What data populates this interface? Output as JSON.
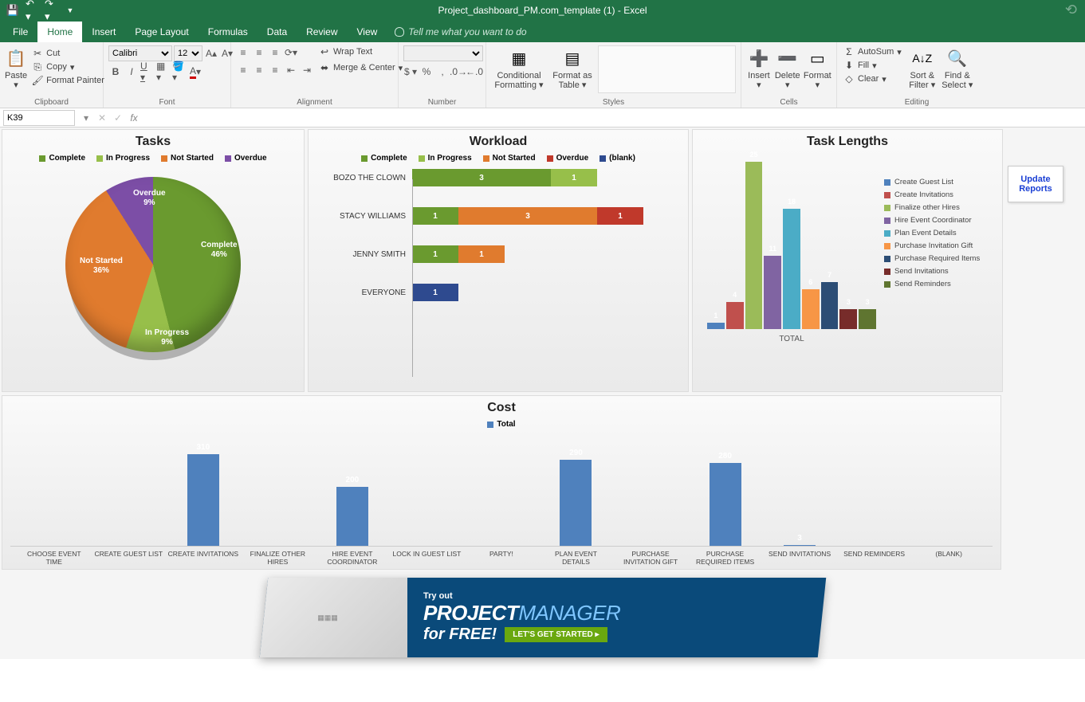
{
  "app": {
    "title": "Project_dashboard_PM.com_template (1) - Excel"
  },
  "qat": {
    "save": "💾",
    "undo": "↶",
    "redo": "↷"
  },
  "tabs": [
    "File",
    "Home",
    "Insert",
    "Page Layout",
    "Formulas",
    "Data",
    "Review",
    "View"
  ],
  "tell_me": "Tell me what you want to do",
  "ribbon": {
    "clipboard": {
      "label": "Clipboard",
      "paste": "Paste",
      "cut": "Cut",
      "copy": "Copy",
      "fmt": "Format Painter"
    },
    "font": {
      "label": "Font",
      "name": "Calibri",
      "size": "12"
    },
    "alignment": {
      "label": "Alignment",
      "wrap": "Wrap Text",
      "merge": "Merge & Center"
    },
    "number": {
      "label": "Number"
    },
    "styles": {
      "label": "Styles",
      "cf": "Conditional Formatting",
      "ft": "Format as Table"
    },
    "cells": {
      "label": "Cells",
      "insert": "Insert",
      "delete": "Delete",
      "format": "Format"
    },
    "editing": {
      "label": "Editing",
      "autosum": "AutoSum",
      "fill": "Fill",
      "clear": "Clear",
      "sort": "Sort & Filter",
      "find": "Find & Select"
    }
  },
  "name_box": "K39",
  "update_reports": "Update Reports",
  "chart_data": [
    {
      "type": "pie",
      "title": "Tasks",
      "legend": [
        "Complete",
        "In Progress",
        "Not Started",
        "Overdue"
      ],
      "series": [
        {
          "name": "Complete",
          "value": 46,
          "pct": "46%",
          "color": "#6a9a2f"
        },
        {
          "name": "In Progress",
          "value": 9,
          "pct": "9%",
          "color": "#97bf4a"
        },
        {
          "name": "Not Started",
          "value": 36,
          "pct": "36%",
          "color": "#e07b2e"
        },
        {
          "name": "Overdue",
          "value": 9,
          "pct": "9%",
          "color": "#7c4ea6"
        }
      ]
    },
    {
      "type": "bar",
      "orientation": "horizontal-stacked",
      "title": "Workload",
      "legend": [
        "Complete",
        "In Progress",
        "Not Started",
        "Overdue",
        "(blank)"
      ],
      "legend_colors": [
        "#6a9a2f",
        "#97bf4a",
        "#e07b2e",
        "#c0392b",
        "#2e4a8f"
      ],
      "categories": [
        "BOZO THE CLOWN",
        "STACY WILLIAMS",
        "JENNY SMITH",
        "EVERYONE"
      ],
      "series": [
        {
          "name": "Complete",
          "values": [
            3,
            1,
            1,
            0
          ],
          "color": "#6a9a2f"
        },
        {
          "name": "In Progress",
          "values": [
            1,
            0,
            0,
            0
          ],
          "color": "#97bf4a"
        },
        {
          "name": "Not Started",
          "values": [
            0,
            3,
            1,
            0
          ],
          "color": "#e07b2e"
        },
        {
          "name": "Overdue",
          "values": [
            0,
            1,
            0,
            0
          ],
          "color": "#c0392b"
        },
        {
          "name": "(blank)",
          "values": [
            0,
            0,
            0,
            1
          ],
          "color": "#2e4a8f"
        }
      ],
      "xlim": [
        0,
        5
      ]
    },
    {
      "type": "bar",
      "title": "Task Lengths",
      "xlabel": "TOTAL",
      "categories": [
        "Create Guest List",
        "Create Invitations",
        "Finalize other Hires",
        "Hire Event Coordinator",
        "Plan Event Details",
        "Purchase Invitation Gift",
        "Purchase Required Items",
        "Send Invitations",
        "Send Reminders"
      ],
      "values": [
        1,
        4,
        25,
        11,
        18,
        6,
        7,
        3,
        3
      ],
      "colors": [
        "#4f81bd",
        "#c0504d",
        "#9bbb59",
        "#8064a2",
        "#4bacc6",
        "#f79646",
        "#2c4d75",
        "#772c2a",
        "#5f7530"
      ],
      "ylim": [
        0,
        25
      ]
    },
    {
      "type": "bar",
      "title": "Cost",
      "legend": [
        "Total"
      ],
      "legend_colors": [
        "#4f81bd"
      ],
      "categories": [
        "CHOOSE EVENT TIME",
        "CREATE GUEST LIST",
        "CREATE INVITATIONS",
        "FINALIZE OTHER HIRES",
        "HIRE EVENT COORDINATOR",
        "LOCK IN GUEST LIST",
        "PARTY!",
        "PLAN EVENT DETAILS",
        "PURCHASE INVITATION GIFT",
        "PURCHASE REQUIRED ITEMS",
        "SEND INVITATIONS",
        "SEND REMINDERS",
        "(BLANK)"
      ],
      "values": [
        0,
        0,
        310,
        0,
        200,
        0,
        0,
        290,
        0,
        280,
        3,
        0,
        0
      ],
      "ylim": [
        0,
        350
      ]
    }
  ],
  "banner": {
    "try": "Try out",
    "brand_a": "PROJECT",
    "brand_b": "MANAGER",
    "free": "for FREE!",
    "cta": "LET'S GET STARTED  ▸"
  }
}
